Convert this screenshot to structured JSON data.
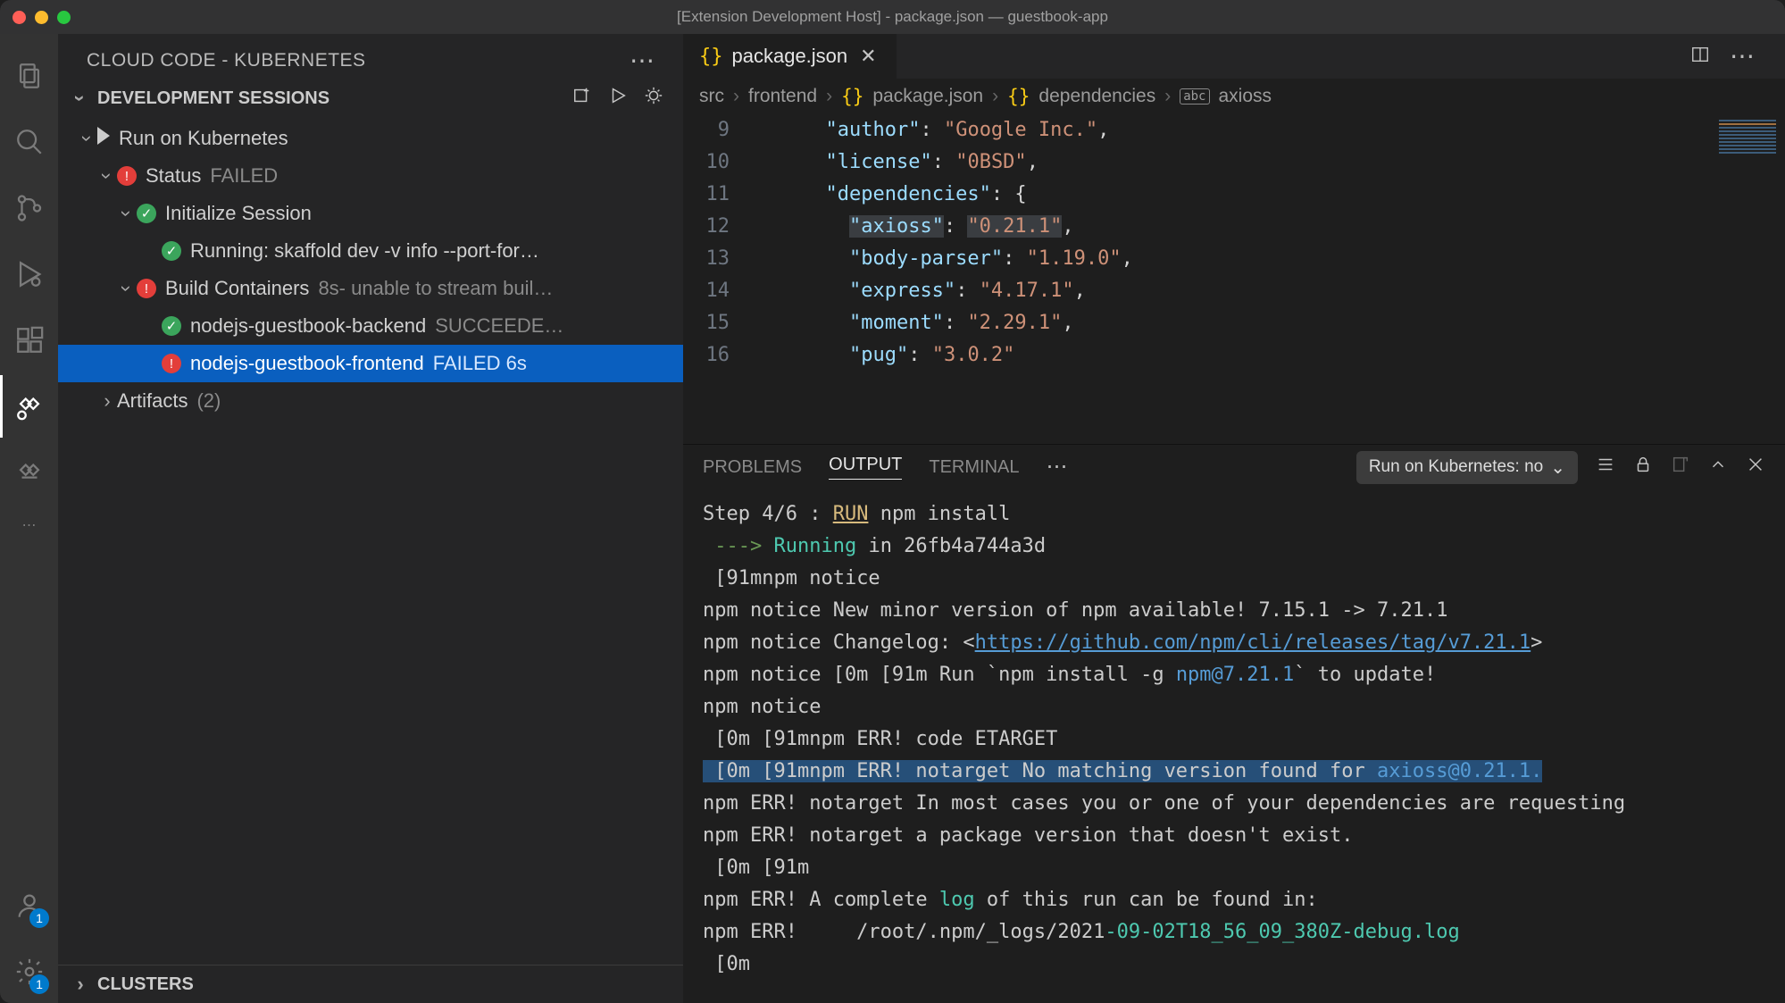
{
  "window": {
    "title": "[Extension Development Host] - package.json — guestbook-app"
  },
  "activity": {
    "items": [
      "files",
      "search",
      "scm",
      "run",
      "extensions",
      "cloudcode",
      "cloudrun",
      "more"
    ],
    "bottom_badges": {
      "account": "1",
      "settings": "1"
    }
  },
  "sidebar": {
    "title": "CLOUD CODE - KUBERNETES",
    "sections": {
      "dev": {
        "label": "DEVELOPMENT SESSIONS"
      },
      "clusters": {
        "label": "CLUSTERS"
      }
    },
    "tree": {
      "run": {
        "label": "Run on Kubernetes"
      },
      "status": {
        "label": "Status",
        "state": "FAILED"
      },
      "init": {
        "label": "Initialize Session"
      },
      "skaffold": {
        "label": "Running: skaffold dev -v info --port-for…"
      },
      "build": {
        "label": "Build Containers",
        "detail": "8s- unable to stream buil…"
      },
      "backend": {
        "label": "nodejs-guestbook-backend",
        "state": "SUCCEEDE…"
      },
      "frontend": {
        "label": "nodejs-guestbook-frontend",
        "state": "FAILED 6s"
      },
      "artifacts": {
        "label": "Artifacts",
        "count": "(2)"
      }
    }
  },
  "editor": {
    "tab": {
      "icon": "{}",
      "name": "package.json"
    },
    "breadcrumb": {
      "parts": [
        "src",
        "frontend",
        "package.json",
        "dependencies",
        "axioss"
      ],
      "icons": {
        "file": "{}",
        "obj": "{}",
        "str": "abc"
      }
    },
    "lines": [
      {
        "n": "9",
        "k": "\"author\"",
        "v": "\"Google Inc.\"",
        "t": ","
      },
      {
        "n": "10",
        "k": "\"license\"",
        "v": "\"0BSD\"",
        "t": ","
      },
      {
        "n": "11",
        "k": "\"dependencies\"",
        "v": "{",
        "t": ""
      },
      {
        "n": "12",
        "k": "\"axioss\"",
        "v": "\"0.21.1\"",
        "t": ",",
        "hl": true
      },
      {
        "n": "13",
        "k": "\"body-parser\"",
        "v": "\"1.19.0\"",
        "t": ","
      },
      {
        "n": "14",
        "k": "\"express\"",
        "v": "\"4.17.1\"",
        "t": ","
      },
      {
        "n": "15",
        "k": "\"moment\"",
        "v": "\"2.29.1\"",
        "t": ","
      },
      {
        "n": "16",
        "k": "\"pug\"",
        "v": "\"3.0.2\"",
        "t": ""
      }
    ]
  },
  "panel": {
    "tabs": {
      "problems": "PROBLEMS",
      "output": "OUTPUT",
      "terminal": "TERMINAL"
    },
    "dropdown": "Run on Kubernetes: no",
    "output": {
      "l1_a": "Step 4/6 : ",
      "l1_b": "RUN",
      "l1_c": " npm install",
      "l2_a": " ---> ",
      "l2_b": "Running",
      "l2_c": " in 26fb4a744a3d",
      "l3": " [91mnpm notice",
      "l4": "npm notice New minor version of npm available! 7.15.1 -> 7.21.1",
      "l5_a": "npm notice Changelog: <",
      "l5_b": "https://github.com/npm/cli/releases/tag/v7.21.1",
      "l5_c": ">",
      "l6_a": "npm notice [0m [91m Run `npm install -g ",
      "l6_b": "npm@7.21.1",
      "l6_c": "` to update!",
      "l7": "npm notice",
      "l8": " [0m [91mnpm ERR! code ETARGET",
      "l9_a": " [0m [91mnpm ERR! notarget No matching version found for ",
      "l9_b": "axioss@0.21.1.",
      "l10": "npm ERR! notarget In most cases you or one of your dependencies are requesting",
      "l11": "npm ERR! notarget a package version that doesn't exist.",
      "l12": " [0m [91m",
      "l13_a": "npm ERR! A complete ",
      "l13_b": "log",
      "l13_c": " of this run can be found in:",
      "l14_a": "npm ERR!     /root/.npm/_logs/2021",
      "l14_b": "-09-02T18_56_09_380Z-debug.log",
      "l15": " [0m"
    }
  }
}
